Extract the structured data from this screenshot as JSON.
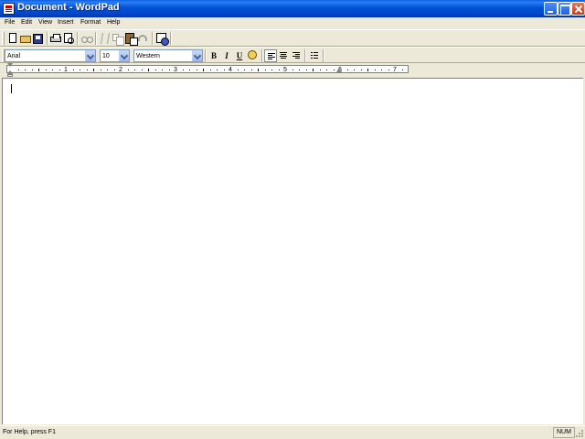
{
  "window": {
    "title": "Document - WordPad"
  },
  "menu": [
    "File",
    "Edit",
    "View",
    "Insert",
    "Format",
    "Help"
  ],
  "format_toolbar": {
    "font_name": "Arial",
    "font_size": "10",
    "script": "Western",
    "bold_label": "B",
    "italic_label": "I",
    "underline_label": "U"
  },
  "ruler": {
    "numbers": [
      "1",
      "2",
      "3",
      "4",
      "5",
      "6",
      "7"
    ]
  },
  "status": {
    "help_text": "For Help, press F1",
    "num": "NUM"
  }
}
